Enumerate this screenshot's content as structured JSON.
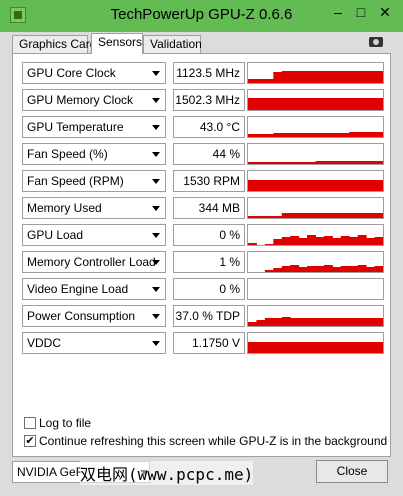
{
  "window": {
    "title": "TechPowerUp GPU-Z 0.6.6",
    "minimize_symbol": "–",
    "maximize_symbol": "□",
    "close_symbol": "✕"
  },
  "tabs": [
    {
      "label": "Graphics Card",
      "active": false
    },
    {
      "label": "Sensors",
      "active": true
    },
    {
      "label": "Validation",
      "active": false
    }
  ],
  "colors": {
    "graph": "#e00000",
    "titlebar": "#63bb54"
  },
  "sensors": [
    {
      "label": "GPU Core Clock",
      "value": "1123.5 MHz",
      "trace": [
        0.2,
        0.2,
        0.2,
        0.55,
        0.6,
        0.6,
        0.6,
        0.6,
        0.6,
        0.6,
        0.6,
        0.6,
        0.6,
        0.6,
        0.6,
        0.6
      ]
    },
    {
      "label": "GPU Memory Clock",
      "value": "1502.3 MHz",
      "trace": [
        0.6,
        0.6,
        0.6,
        0.6,
        0.6,
        0.6,
        0.6,
        0.6,
        0.6,
        0.6,
        0.6,
        0.6,
        0.6,
        0.6,
        0.6,
        0.6
      ]
    },
    {
      "label": "GPU Temperature",
      "value": "43.0 °C",
      "trace": [
        0.15,
        0.15,
        0.15,
        0.2,
        0.2,
        0.22,
        0.22,
        0.22,
        0.22,
        0.22,
        0.22,
        0.22,
        0.24,
        0.24,
        0.24,
        0.24
      ]
    },
    {
      "label": "Fan Speed (%)",
      "value": "44 %",
      "trace": [
        0.1,
        0.1,
        0.1,
        0.1,
        0.12,
        0.12,
        0.12,
        0.12,
        0.14,
        0.14,
        0.14,
        0.14,
        0.14,
        0.14,
        0.14,
        0.14
      ]
    },
    {
      "label": "Fan Speed (RPM)",
      "value": "1530 RPM",
      "trace": [
        0.55,
        0.55,
        0.55,
        0.55,
        0.55,
        0.55,
        0.55,
        0.55,
        0.55,
        0.55,
        0.55,
        0.55,
        0.55,
        0.55,
        0.55,
        0.55
      ]
    },
    {
      "label": "Memory Used",
      "value": "344 MB",
      "trace": [
        0.1,
        0.1,
        0.1,
        0.1,
        0.25,
        0.25,
        0.25,
        0.25,
        0.25,
        0.25,
        0.25,
        0.25,
        0.25,
        0.25,
        0.25,
        0.25
      ]
    },
    {
      "label": "GPU Load",
      "value": "0 %",
      "trace": [
        0.1,
        0.0,
        0.05,
        0.3,
        0.4,
        0.45,
        0.35,
        0.5,
        0.4,
        0.45,
        0.35,
        0.45,
        0.4,
        0.5,
        0.35,
        0.4
      ]
    },
    {
      "label": "Memory Controller Load",
      "value": "1 %",
      "trace": [
        0.0,
        0.0,
        0.1,
        0.2,
        0.3,
        0.35,
        0.25,
        0.3,
        0.3,
        0.35,
        0.25,
        0.3,
        0.3,
        0.35,
        0.25,
        0.3
      ]
    },
    {
      "label": "Video Engine Load",
      "value": "0 %",
      "trace": [
        0,
        0,
        0,
        0,
        0,
        0,
        0,
        0,
        0,
        0,
        0,
        0,
        0,
        0,
        0,
        0
      ]
    },
    {
      "label": "Power Consumption",
      "value": "37.0 % TDP",
      "trace": [
        0.2,
        0.3,
        0.4,
        0.4,
        0.45,
        0.42,
        0.4,
        0.42,
        0.4,
        0.42,
        0.4,
        0.38,
        0.4,
        0.4,
        0.38,
        0.4
      ]
    },
    {
      "label": "VDDC",
      "value": "1.1750 V",
      "trace": [
        0.55,
        0.55,
        0.55,
        0.55,
        0.55,
        0.55,
        0.55,
        0.55,
        0.55,
        0.55,
        0.55,
        0.55,
        0.55,
        0.55,
        0.55,
        0.55
      ]
    }
  ],
  "options": {
    "log_to_file": {
      "label": "Log to file",
      "checked": false
    },
    "continue_refreshing": {
      "label": "Continue refreshing this screen while GPU-Z is in the background",
      "checked": true
    }
  },
  "footer": {
    "gpu_select": "NVIDIA GeF",
    "watermark": "双电网(www.pcpc.me)",
    "close_label": "Close"
  }
}
